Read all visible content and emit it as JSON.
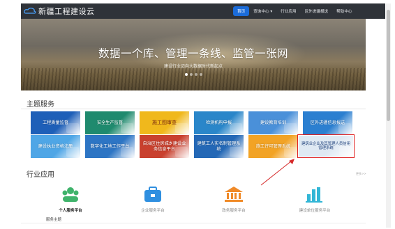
{
  "header": {
    "logo_text": "新疆工程建设云",
    "nav": [
      {
        "label": "首页",
        "active": true
      },
      {
        "label": "查询中心 ▾",
        "active": false
      },
      {
        "label": "行业应用",
        "active": false
      },
      {
        "label": "区外进疆报送",
        "active": false
      },
      {
        "label": "帮助中心",
        "active": false
      }
    ]
  },
  "banner": {
    "title": "数据一个库、管理一条线、监管一张网",
    "subtitle": "建设行业迈向大数据时代新起点",
    "slides": 4,
    "active_slide": 0
  },
  "services": {
    "title": "主题服务",
    "tiles": [
      {
        "label": "工程质量监督",
        "color": "#1e5fb8"
      },
      {
        "label": "安全生产监督",
        "color": "#1f8a6e"
      },
      {
        "label": "施工图审查",
        "color": "#f0b81c"
      },
      {
        "label": "检测机构申报",
        "color": "#2a86c9"
      },
      {
        "label": "建设教育培训",
        "color": "#4a90d9"
      },
      {
        "label": "区外进疆信息报送",
        "color": "#2b7fd0"
      },
      {
        "label": "建设执业资格注册",
        "color": "#4fa6e6"
      },
      {
        "label": "数字化工地工作平台",
        "color": "#2d75c4"
      },
      {
        "label": "自治区住房城乡建设业务信息平台",
        "color": "#c9402e"
      },
      {
        "label": "建筑工人实名制管理系统",
        "color": "#2468b6"
      },
      {
        "label": "施工许可管理系统",
        "color": "#f2a325"
      },
      {
        "label": "建筑业企业及其管理人员信用管理系统",
        "color": "#dfe9f3"
      }
    ]
  },
  "industry": {
    "title": "行业应用",
    "more": "更多>>",
    "apps": [
      {
        "label": "个人服务平台",
        "icon": "people-icon",
        "color": "#3fb36b",
        "bold": true
      },
      {
        "label": "企业服务平台",
        "icon": "enterprise-icon",
        "color": "#2f8fe0",
        "bold": false
      },
      {
        "label": "政务服务平台",
        "icon": "government-icon",
        "color": "#f08a28",
        "bold": false
      },
      {
        "label": "建设单位服务平台",
        "icon": "building-chart-icon",
        "color": "#32b6d6",
        "bold": false
      }
    ],
    "footer_label": "服务主题"
  }
}
